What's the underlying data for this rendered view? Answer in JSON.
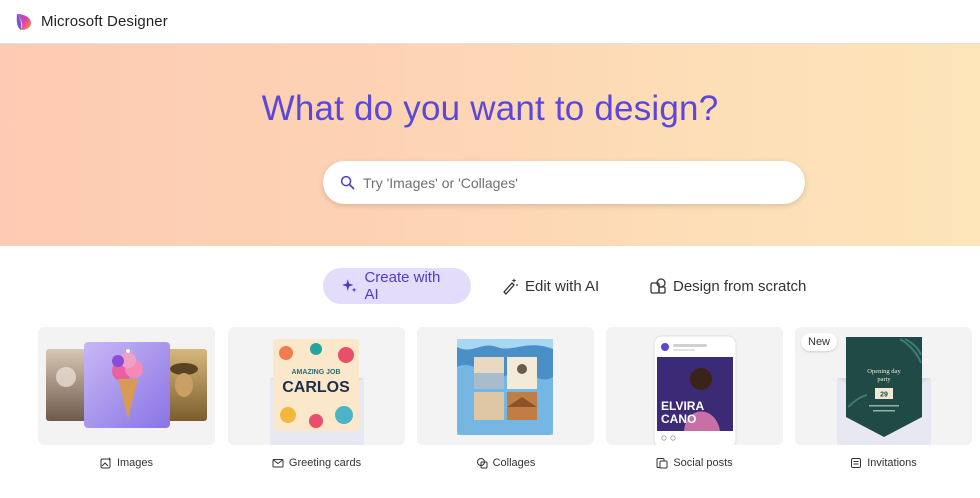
{
  "header": {
    "app_title": "Microsoft Designer"
  },
  "hero": {
    "title": "What do you want to design?",
    "search_placeholder": "Try 'Images' or 'Collages'"
  },
  "tabs": [
    {
      "label": "Create with AI",
      "icon": "sparkle-icon",
      "active": true
    },
    {
      "label": "Edit with AI",
      "icon": "magic-wand-icon",
      "active": false
    },
    {
      "label": "Design from scratch",
      "icon": "shapes-icon",
      "active": false
    }
  ],
  "cards": [
    {
      "label": "Images",
      "icon": "image-sparkle-icon"
    },
    {
      "label": "Greeting cards",
      "icon": "mail-icon",
      "preview_text": [
        "AMAZING JOB",
        "CARLOS"
      ]
    },
    {
      "label": "Collages",
      "icon": "collage-icon"
    },
    {
      "label": "Social posts",
      "icon": "social-post-icon",
      "preview_text": [
        "ELVIRA",
        "CANO"
      ]
    },
    {
      "label": "Invitations",
      "icon": "invitation-icon",
      "badge": "New",
      "preview_text": [
        "Opening day",
        "party",
        "29"
      ]
    }
  ],
  "colors": {
    "accent": "#5b47d8",
    "tab_active_bg": "#e3dcfb",
    "hero_gradient_start": "#fdcbb3",
    "hero_gradient_end": "#fde4b9"
  }
}
